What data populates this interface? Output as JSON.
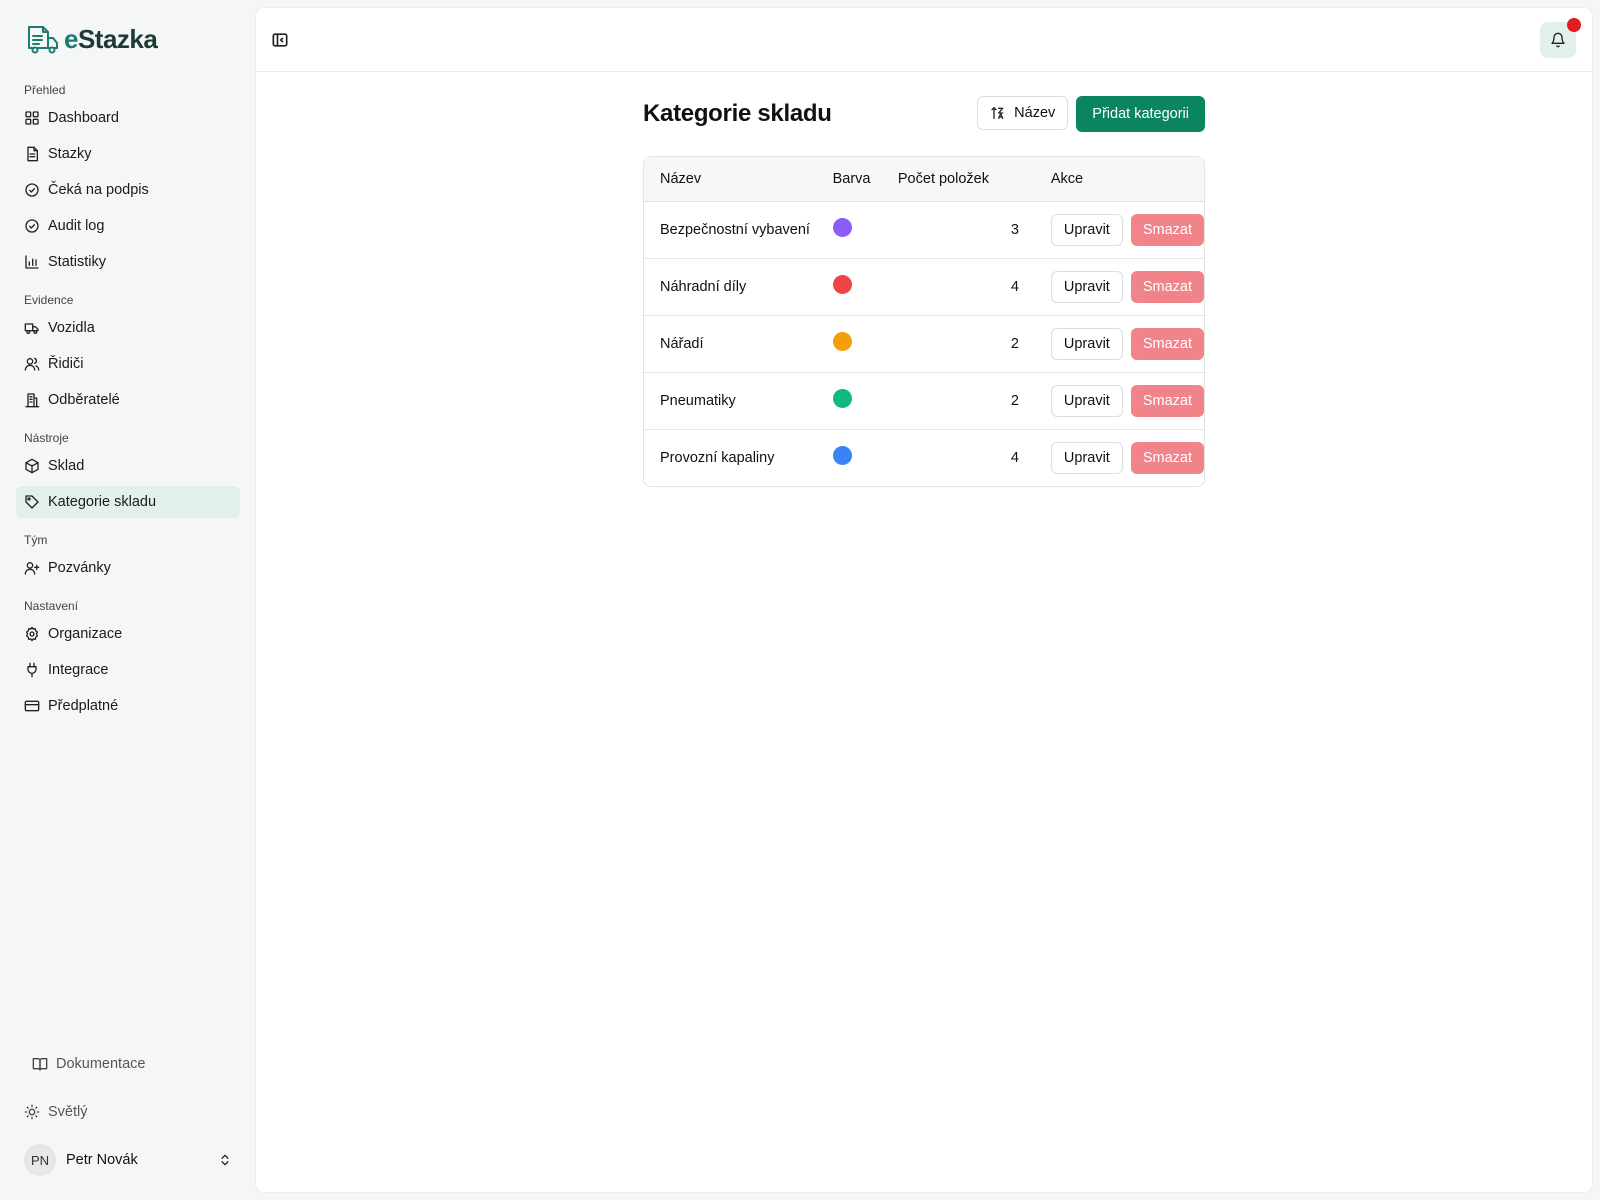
{
  "brand": {
    "prefix": "e",
    "name": "Stazka"
  },
  "sidebar": {
    "sections": [
      {
        "label": "Přehled",
        "items": [
          {
            "label": "Dashboard",
            "icon": "grid-icon"
          },
          {
            "label": "Stazky",
            "icon": "document-icon"
          },
          {
            "label": "Čeká na podpis",
            "icon": "check-circle-icon"
          },
          {
            "label": "Audit log",
            "icon": "check-circle-icon"
          },
          {
            "label": "Statistiky",
            "icon": "bar-chart-icon"
          }
        ]
      },
      {
        "label": "Evidence",
        "items": [
          {
            "label": "Vozidla",
            "icon": "truck-icon"
          },
          {
            "label": "Řidiči",
            "icon": "users-icon"
          },
          {
            "label": "Odběratelé",
            "icon": "building-icon"
          }
        ]
      },
      {
        "label": "Nástroje",
        "items": [
          {
            "label": "Sklad",
            "icon": "package-icon"
          },
          {
            "label": "Kategorie skladu",
            "icon": "tag-icon",
            "active": true
          }
        ]
      },
      {
        "label": "Tým",
        "items": [
          {
            "label": "Pozvánky",
            "icon": "user-plus-icon"
          }
        ]
      },
      {
        "label": "Nastavení",
        "items": [
          {
            "label": "Organizace",
            "icon": "gear-icon"
          },
          {
            "label": "Integrace",
            "icon": "plug-icon"
          },
          {
            "label": "Předplatné",
            "icon": "credit-card-icon"
          }
        ]
      }
    ],
    "docs_label": "Dokumentace",
    "theme_label": "Světlý",
    "user": {
      "initials": "PN",
      "name": "Petr Novák"
    }
  },
  "page": {
    "title": "Kategorie skladu",
    "sort_label": "Název",
    "add_label": "Přidat kategorii"
  },
  "table": {
    "headers": {
      "name": "Název",
      "color": "Barva",
      "count": "Počet položek",
      "actions": "Akce"
    },
    "edit_label": "Upravit",
    "delete_label": "Smazat",
    "rows": [
      {
        "name": "Bezpečnostní vybavení",
        "color": "#8b5cf6",
        "count": "3"
      },
      {
        "name": "Náhradní díly",
        "color": "#ef4444",
        "count": "4"
      },
      {
        "name": "Nářadí",
        "color": "#f59e0b",
        "count": "2"
      },
      {
        "name": "Pneumatiky",
        "color": "#10b981",
        "count": "2"
      },
      {
        "name": "Provozní kapaliny",
        "color": "#3b82f6",
        "count": "4"
      }
    ]
  },
  "colors": {
    "accent": "#0a8560",
    "danger": "#f0848a",
    "active_bg": "#e3f0ea"
  }
}
